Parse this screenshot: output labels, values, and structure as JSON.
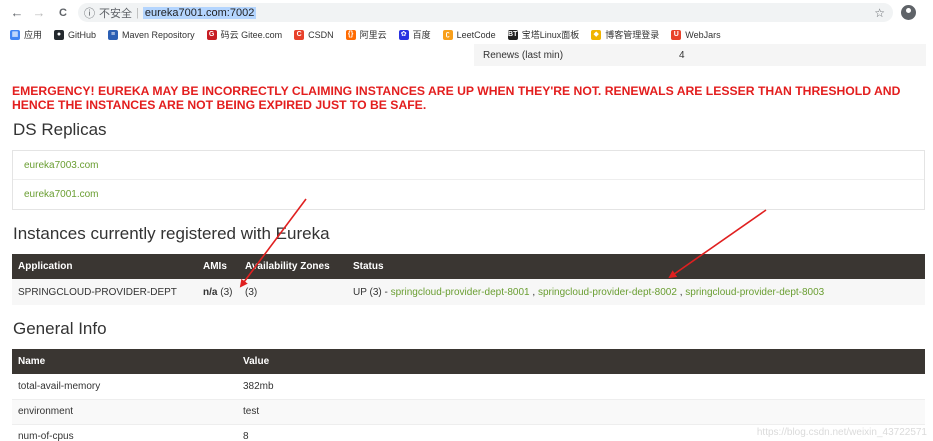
{
  "browser": {
    "back_icon": "←",
    "forward_icon": "→",
    "reload_icon": "C",
    "info_icon": "ⓘ",
    "security_label": "不安全",
    "separator": "|",
    "url": "eureka7001.com:7002",
    "star_icon": "☆",
    "bookmarks": [
      {
        "label": "应用",
        "icon": "apps-icon",
        "color": "#4285f4",
        "glyph": "▦"
      },
      {
        "label": "GitHub",
        "icon": "github-icon",
        "color": "#24292e",
        "glyph": "●"
      },
      {
        "label": "Maven Repository",
        "icon": "maven-icon",
        "color": "#2b5fb4",
        "glyph": "≡"
      },
      {
        "label": "码云 Gitee.com",
        "icon": "gitee-icon",
        "color": "#c71d23",
        "glyph": "G"
      },
      {
        "label": "CSDN",
        "icon": "csdn-icon",
        "color": "#e8412b",
        "glyph": "C"
      },
      {
        "label": "阿里云",
        "icon": "aliyun-icon",
        "color": "#ff6a00",
        "glyph": "{}"
      },
      {
        "label": "百度",
        "icon": "baidu-icon",
        "color": "#2932e1",
        "glyph": "✿"
      },
      {
        "label": "LeetCode",
        "icon": "leetcode-icon",
        "color": "#f89f1b",
        "glyph": "ʗ"
      },
      {
        "label": "宝塔Linux面板",
        "icon": "bt-icon",
        "color": "#222222",
        "glyph": "BT"
      },
      {
        "label": "博客管理登录",
        "icon": "blog-icon",
        "color": "#f0b400",
        "glyph": "◆"
      },
      {
        "label": "WebJars",
        "icon": "webjars-icon",
        "color": "#e8412b",
        "glyph": "U"
      }
    ]
  },
  "renews": {
    "key": "Renews (last min)",
    "value": "4"
  },
  "emergency": "EMERGENCY! EUREKA MAY BE INCORRECTLY CLAIMING INSTANCES ARE UP WHEN THEY'RE NOT. RENEWALS ARE LESSER THAN THRESHOLD AND HENCE THE INSTANCES ARE NOT BEING EXPIRED JUST TO BE SAFE.",
  "ds_replicas": {
    "title": "DS Replicas",
    "items": [
      "eureka7003.com",
      "eureka7001.com"
    ]
  },
  "instances": {
    "title": "Instances currently registered with Eureka",
    "headers": [
      "Application",
      "AMIs",
      "Availability Zones",
      "Status"
    ],
    "row": {
      "application": "SPRINGCLOUD-PROVIDER-DEPT",
      "amis_bold": "n/a",
      "amis_count": "(3)",
      "zones": "(3)",
      "status_prefix": "UP (3) - ",
      "links": [
        "springcloud-provider-dept-8001",
        "springcloud-provider-dept-8002",
        "springcloud-provider-dept-8003"
      ],
      "link_separator": " , "
    }
  },
  "general_info": {
    "title": "General Info",
    "headers": [
      "Name",
      "Value"
    ],
    "rows": [
      {
        "name": "total-avail-memory",
        "value": "382mb"
      },
      {
        "name": "environment",
        "value": "test"
      },
      {
        "name": "num-of-cpus",
        "value": "8"
      }
    ]
  },
  "watermark": "https://blog.csdn.net/weixin_43722571",
  "colors": {
    "header_bg": "#3a3632",
    "link": "#6a9e32",
    "emergency": "#e31e1e",
    "arrow": "#e02020"
  }
}
